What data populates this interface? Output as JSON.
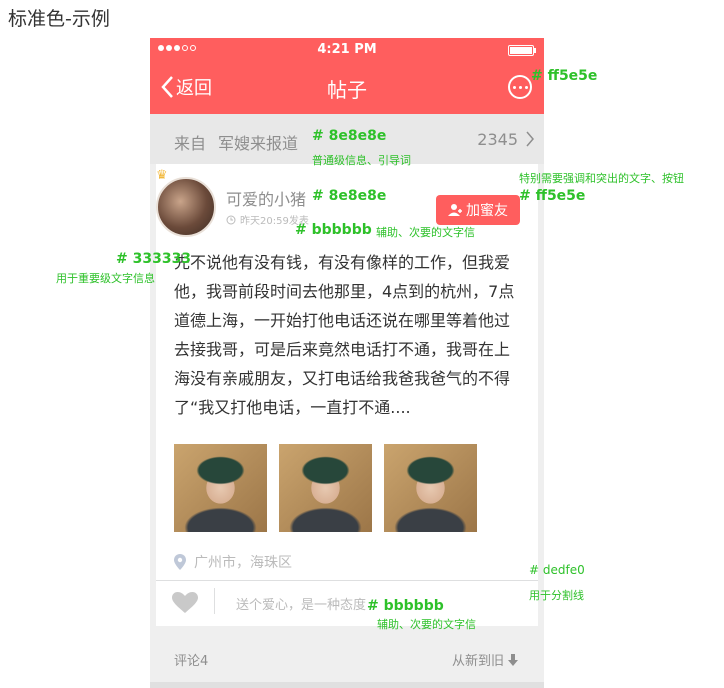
{
  "page_title": "标准色-示例",
  "status_bar": {
    "time": "4:21 PM"
  },
  "nav": {
    "back_label": "返回",
    "title": "帖子"
  },
  "source": {
    "prefix": "来自",
    "name": "军嫂来报道",
    "count": "2345"
  },
  "post": {
    "username": "可爱的小猪",
    "time": "昨天20:59发表",
    "add_friend_label": "加蜜友",
    "body": "先不说他有没有钱，有没有像样的工作，但我爱他，我哥前段时间去他那里，4点到的杭州，7点道德上海，一开始打他电话还说在哪里等着他过去接我哥，可是后来竟然电话打不通，我哥在上海没有亲戚朋友，又打电话给我爸我爸气的不得了“我又打他电话，一直打不通....",
    "location": "广州市，海珠区",
    "like_text": "送个爱心，是一种态度"
  },
  "comments": {
    "count_label": "评论4",
    "sort_label": "从新到旧"
  },
  "annotations": [
    {
      "code": "# ff5e5e",
      "desc": ""
    },
    {
      "code": "# 8e8e8e",
      "desc": "普通级信息、引导词"
    },
    {
      "code": "",
      "desc": "特别需要强调和突出的文字、按钮"
    },
    {
      "code": "# 8e8e8e",
      "desc": ""
    },
    {
      "code": "# ff5e5e",
      "desc": ""
    },
    {
      "code": "# bbbbbb",
      "desc": "辅助、次要的文字信"
    },
    {
      "code": "# 333333",
      "desc": "用于重要级文字信息"
    },
    {
      "code": "# dedfe0",
      "desc": "用于分割线"
    },
    {
      "code": "# bbbbbb",
      "desc": "辅助、次要的文字信"
    }
  ],
  "colors": {
    "accent": "#ff5e5e",
    "normal_text": "#8e8e8e",
    "secondary_text": "#bbbbbb",
    "primary_text": "#333333",
    "divider": "#dedfe0"
  },
  "icons": [
    "back-chevron-icon",
    "more-icon",
    "chevron-right-icon",
    "crown-icon",
    "clock-icon",
    "add-user-icon",
    "location-pin-icon",
    "heart-icon",
    "arrow-down-icon"
  ]
}
